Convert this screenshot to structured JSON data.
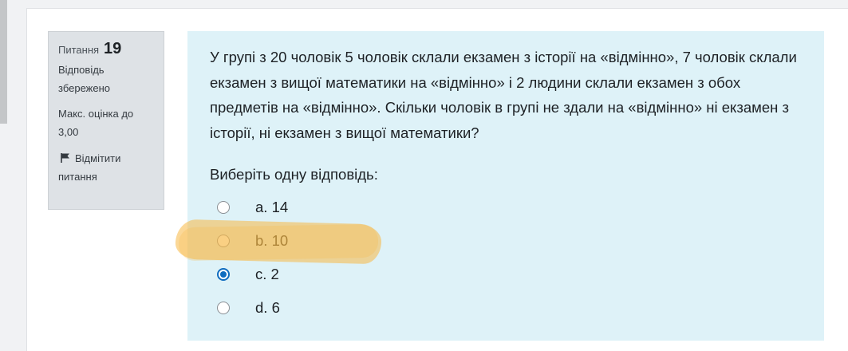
{
  "question_info": {
    "label": "Питання",
    "number": "19",
    "state": "Відповідь збережено",
    "grade": "Макс. оцінка до 3,00",
    "flag_label": "Відмітити питання",
    "flag_icon": "flag-icon"
  },
  "question": {
    "text": "У групі з 20 чоловік 5 чоловік склали екзамен з історії на «відмінно», 7 чоловік склали екзамен з вищої математики на «відмінно» і 2 людини склали екзамен з обох предметів на «відмінно». Скільки чоловік в групі не здали на «відмінно» ні екзамен з історії, ні екзамен з вищої математики?",
    "prompt": "Виберіть одну відповідь:",
    "answers": [
      {
        "label": "a. 14",
        "checked": false
      },
      {
        "label": "b. 10",
        "checked": false
      },
      {
        "label": "c. 2",
        "checked": true
      },
      {
        "label": "d. 6",
        "checked": false
      }
    ]
  },
  "colors": {
    "info_background": "#dee2e6",
    "content_background": "#def2f8",
    "radio_selected": "#0f6cbf",
    "marker_highlight": "#f7b844"
  }
}
